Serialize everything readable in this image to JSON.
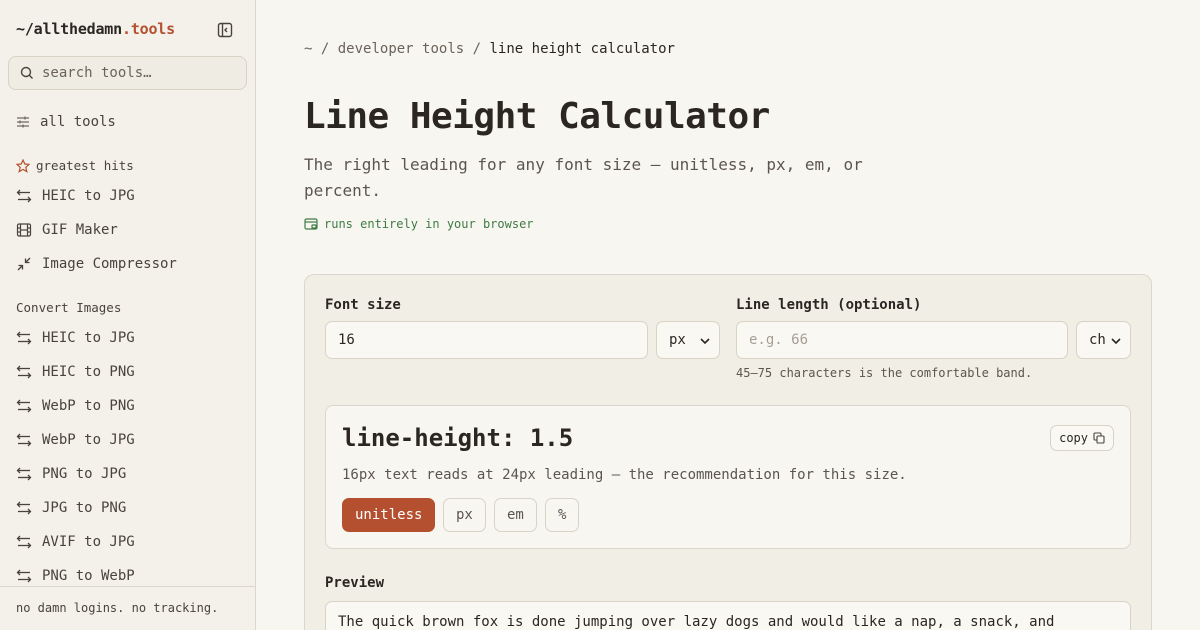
{
  "sidebar": {
    "brand_prefix": "~/allthedamn",
    "brand_suffix": ".tools",
    "search_placeholder": "search tools…",
    "all_tools": "all tools",
    "greatest_hits_title": "greatest hits",
    "greatest_hits": [
      {
        "label": "HEIC to JPG",
        "icon": "swap-arrows-icon"
      },
      {
        "label": "GIF Maker",
        "icon": "film-icon"
      },
      {
        "label": "Image Compressor",
        "icon": "compress-icon"
      }
    ],
    "convert_images_title": "Convert Images",
    "convert_images": [
      {
        "label": "HEIC to JPG"
      },
      {
        "label": "HEIC to PNG"
      },
      {
        "label": "WebP to PNG"
      },
      {
        "label": "WebP to JPG"
      },
      {
        "label": "PNG to JPG"
      },
      {
        "label": "JPG to PNG"
      },
      {
        "label": "AVIF to JPG"
      },
      {
        "label": "PNG to WebP"
      }
    ],
    "footer": "no damn logins. no tracking."
  },
  "breadcrumb": {
    "root": "~",
    "sep": "/",
    "category": "developer tools",
    "current": "line height calculator"
  },
  "page": {
    "title": "Line Height Calculator",
    "subtitle": "The right leading for any font size — unitless, px, em, or percent.",
    "browser_note": "runs entirely in your browser"
  },
  "form": {
    "font_size_label": "Font size",
    "font_size_value": "16",
    "font_size_unit": "px",
    "line_length_label": "Line length (optional)",
    "line_length_placeholder": "e.g. 66",
    "line_length_unit": "ch",
    "line_length_hint": "45–75 characters is the comfortable band."
  },
  "result": {
    "value": "line-height: 1.5",
    "copy_label": "copy",
    "description": "16px text reads at 24px leading — the recommendation for this size.",
    "units": [
      {
        "label": "unitless",
        "active": true
      },
      {
        "label": "px",
        "active": false
      },
      {
        "label": "em",
        "active": false
      },
      {
        "label": "%",
        "active": false
      }
    ]
  },
  "preview": {
    "label": "Preview",
    "text": "The quick brown fox is done jumping over lazy dogs and would like a nap, a snack, and"
  },
  "colors": {
    "accent": "#b4502f",
    "green": "#3f7a45",
    "background": "#f8f6f1"
  }
}
